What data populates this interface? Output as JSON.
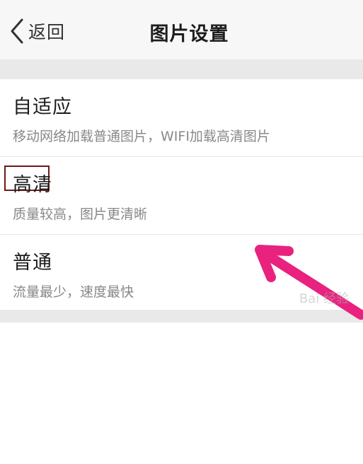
{
  "header": {
    "back_label": "返回",
    "title": "图片设置"
  },
  "options": [
    {
      "title": "自适应",
      "description": "移动网络加载普通图片，WIFI加载高清图片"
    },
    {
      "title": "高清",
      "description": "质量较高，图片更清晰"
    },
    {
      "title": "普通",
      "description": "流量最少，速度最快"
    }
  ],
  "annotation": {
    "highlighted_option": "高清",
    "arrow_color": "#e8227e",
    "highlight_color": "#6b1a1a"
  },
  "watermark": "Bai 经验"
}
